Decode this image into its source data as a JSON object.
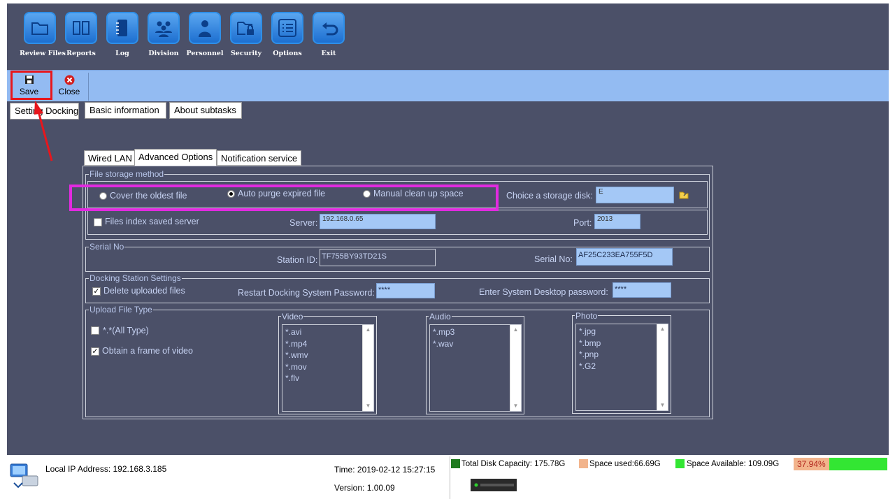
{
  "toolbar": {
    "items": [
      {
        "label": "Review Files",
        "icon": "folder-icon"
      },
      {
        "label": "Reports",
        "icon": "book-icon"
      },
      {
        "label": "Log",
        "icon": "notebook-icon"
      },
      {
        "label": "Division",
        "icon": "group-icon"
      },
      {
        "label": "Personnel",
        "icon": "person-icon"
      },
      {
        "label": "Security",
        "icon": "folder-lock-icon"
      },
      {
        "label": "Options",
        "icon": "list-icon"
      },
      {
        "label": "Exit",
        "icon": "return-arrow-icon"
      }
    ]
  },
  "actions": {
    "save": "Save",
    "close": "Close"
  },
  "tabs": [
    "Setting Docking",
    "Basic information",
    "About subtasks"
  ],
  "inner_tabs": [
    "Wired LAN",
    "Advanced Options",
    "Notification service"
  ],
  "storage": {
    "title": "File storage method",
    "options": [
      "Cover the oldest file",
      "Auto purge expired file",
      "Manual clean up space"
    ],
    "selected_index": 1,
    "disk_label": "Choice a storage disk:",
    "disk_value": "E",
    "index_server_label": "Files index saved server",
    "server_label": "Server:",
    "server_value": "192.168.0.65",
    "port_label": "Port:",
    "port_value": "2013"
  },
  "serial": {
    "title": "Serial No",
    "station_label": "Station ID:",
    "station_value": "TF755BY93TD21S",
    "serial_label": "Serial No:",
    "serial_value": "AF25C233EA755F5D"
  },
  "docking": {
    "title": "Docking Station Settings",
    "delete_label": "Delete uploaded files",
    "delete_checked": true,
    "restart_label": "Restart Docking System Password:",
    "restart_value": "****",
    "desktop_label": "Enter System Desktop password:",
    "desktop_value": "****"
  },
  "upload": {
    "title": "Upload File Type",
    "all_type_label": "*.*(All Type)",
    "all_type_checked": false,
    "frame_label": "Obtain a frame of video",
    "frame_checked": true,
    "video_title": "Video",
    "video_types": [
      "*.avi",
      "*.mp4",
      "*.wmv",
      "*.mov",
      "*.flv"
    ],
    "audio_title": "Audio",
    "audio_types": [
      "*.mp3",
      "*.wav"
    ],
    "photo_title": "Photo",
    "photo_types": [
      "*.jpg",
      "*.bmp",
      "*.pnp",
      "*.G2"
    ]
  },
  "status": {
    "ip": "Local IP Address: 192.168.3.185",
    "time": "Time:  2019-02-12 15:27:15",
    "version": "Version:  1.00.09",
    "total": "Total Disk Capacity: 175.78G",
    "used": "Space used:66.69G",
    "available": "Space Available: 109.09G",
    "percent": "37.94%",
    "usage_fraction": 0.3794
  },
  "colors": {
    "highlight_red": "#e8161c",
    "highlight_magenta": "#e22ae0",
    "total_green": "#1f7a1f",
    "used_orange": "#f2b48c",
    "available_green": "#33e633"
  }
}
